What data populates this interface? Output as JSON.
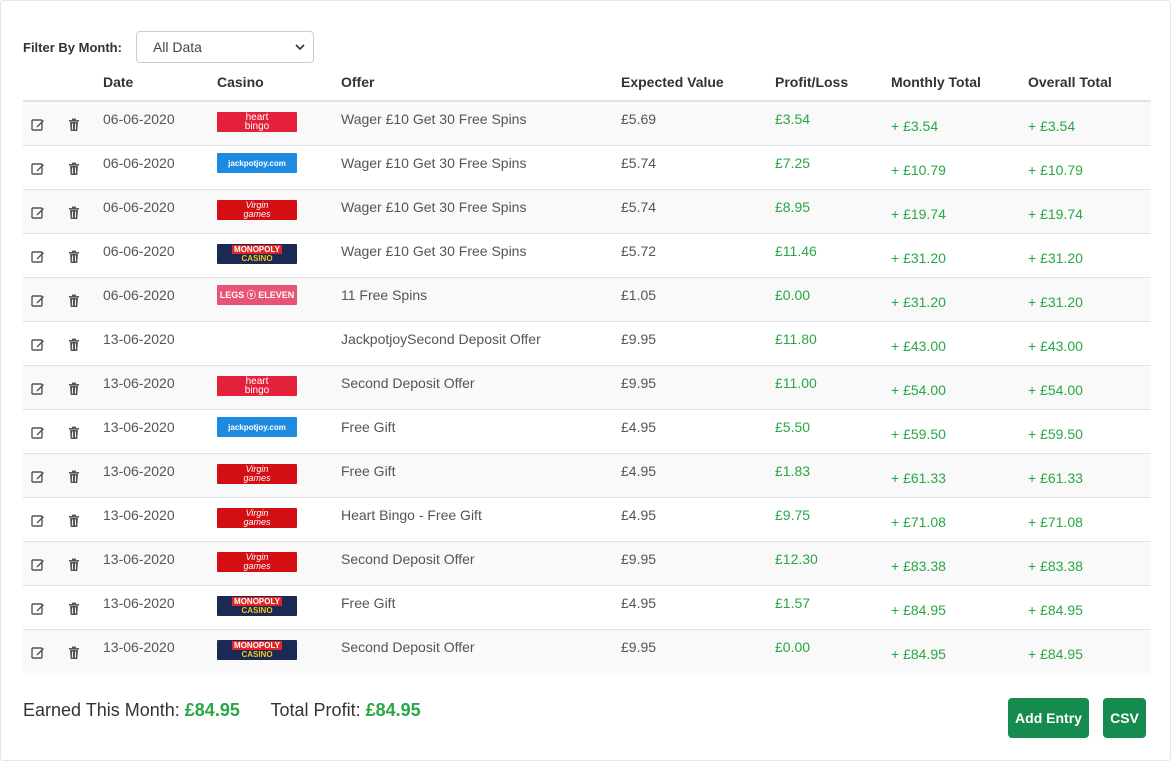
{
  "filter": {
    "label": "Filter By Month:",
    "selected": "All Data"
  },
  "columns": [
    "Date",
    "Casino",
    "Offer",
    "Expected Value",
    "Profit/Loss",
    "Monthly Total",
    "Overall Total"
  ],
  "casinos": {
    "heart": {
      "line1": "heart",
      "line2": "bingo"
    },
    "jackpot": {
      "line1": "jackpotjoy.com",
      "line2": ""
    },
    "virgin": {
      "line1": "Virgin",
      "line2": "games"
    },
    "monopoly": {
      "line1": "MONOPOLY",
      "line2": "CASINO"
    },
    "legs": {
      "line1": "LEGS",
      "line2": "ELEVEN"
    }
  },
  "rows": [
    {
      "date": "06-06-2020",
      "casino": "heart",
      "offer": "Wager £10 Get 30 Free Spins",
      "ev": "£5.69",
      "pl": "£3.54",
      "monthly": "+ £3.54",
      "overall": "+ £3.54"
    },
    {
      "date": "06-06-2020",
      "casino": "jackpot",
      "offer": "Wager £10 Get 30 Free Spins",
      "ev": "£5.74",
      "pl": "£7.25",
      "monthly": "+ £10.79",
      "overall": "+ £10.79"
    },
    {
      "date": "06-06-2020",
      "casino": "virgin",
      "offer": "Wager £10 Get 30 Free Spins",
      "ev": "£5.74",
      "pl": "£8.95",
      "monthly": "+ £19.74",
      "overall": "+ £19.74"
    },
    {
      "date": "06-06-2020",
      "casino": "monopoly",
      "offer": "Wager £10 Get 30 Free Spins",
      "ev": "£5.72",
      "pl": "£11.46",
      "monthly": "+ £31.20",
      "overall": "+ £31.20"
    },
    {
      "date": "06-06-2020",
      "casino": "legs",
      "offer": "11 Free Spins",
      "ev": "£1.05",
      "pl": "£0.00",
      "monthly": "+ £31.20",
      "overall": "+ £31.20"
    },
    {
      "date": "13-06-2020",
      "casino": "",
      "offer": "JackpotjoySecond Deposit Offer",
      "ev": "£9.95",
      "pl": "£11.80",
      "monthly": "+ £43.00",
      "overall": "+ £43.00"
    },
    {
      "date": "13-06-2020",
      "casino": "heart",
      "offer": "Second Deposit Offer",
      "ev": "£9.95",
      "pl": "£11.00",
      "monthly": "+ £54.00",
      "overall": "+ £54.00"
    },
    {
      "date": "13-06-2020",
      "casino": "jackpot",
      "offer": "Free Gift",
      "ev": "£4.95",
      "pl": "£5.50",
      "monthly": "+ £59.50",
      "overall": "+ £59.50"
    },
    {
      "date": "13-06-2020",
      "casino": "virgin",
      "offer": "Free Gift",
      "ev": "£4.95",
      "pl": "£1.83",
      "monthly": "+ £61.33",
      "overall": "+ £61.33"
    },
    {
      "date": "13-06-2020",
      "casino": "virgin",
      "offer": "Heart Bingo - Free Gift",
      "ev": "£4.95",
      "pl": "£9.75",
      "monthly": "+ £71.08",
      "overall": "+ £71.08"
    },
    {
      "date": "13-06-2020",
      "casino": "virgin",
      "offer": "Second Deposit Offer",
      "ev": "£9.95",
      "pl": "£12.30",
      "monthly": "+ £83.38",
      "overall": "+ £83.38"
    },
    {
      "date": "13-06-2020",
      "casino": "monopoly",
      "offer": "Free Gift",
      "ev": "£4.95",
      "pl": "£1.57",
      "monthly": "+ £84.95",
      "overall": "+ £84.95"
    },
    {
      "date": "13-06-2020",
      "casino": "monopoly",
      "offer": "Second Deposit Offer",
      "ev": "£9.95",
      "pl": "£0.00",
      "monthly": "+ £84.95",
      "overall": "+ £84.95"
    }
  ],
  "summary": {
    "earned_label": "Earned This Month:",
    "earned_value": "£84.95",
    "total_label": "Total Profit:",
    "total_value": "£84.95"
  },
  "buttons": {
    "add": "Add Entry",
    "csv": "CSV"
  },
  "colors": {
    "green_text": "#28a745",
    "button_green": "#168b4f"
  }
}
